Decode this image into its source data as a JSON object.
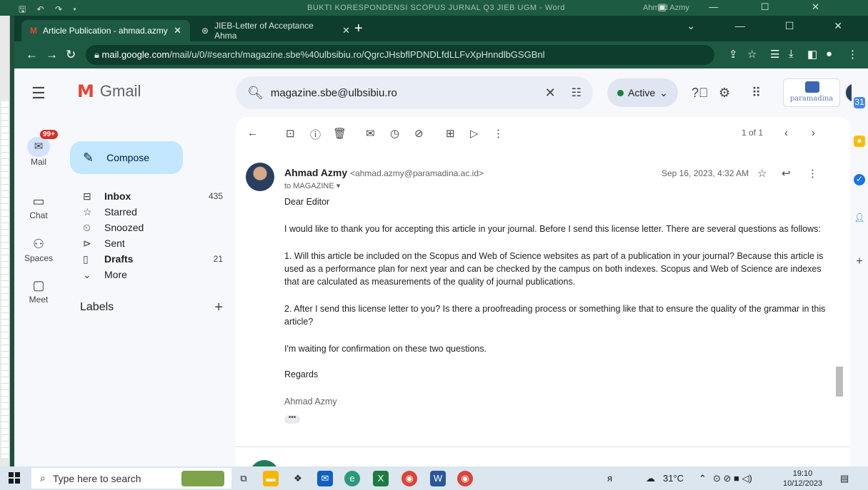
{
  "word": {
    "quick_access": "🖫 ↶ ↷ ▾",
    "document_title": "BUKTI KORESPONDENSI SCOPUS JURNAL Q3 JIEB UGM - Word",
    "user": "Ahmad Azmy",
    "user_initials": "AA",
    "window_controls": "▣ — ☐ ✕"
  },
  "browser": {
    "tabs": [
      {
        "label": "Article Publication - ahmad.azmy",
        "favicon": "M"
      },
      {
        "label": "JIEB-Letter of Acceptance Ahma",
        "favicon": "⊛"
      }
    ],
    "new_tab": "+",
    "window_controls": "⌄ — ☐ ✕",
    "url_host": "mail.google.com",
    "url_path": "/mail/u/0/#search/magazine.sbe%40ulbsibiu.ro/QgrcJHsbflPDNDLfdLLFvXpHnndlbGSGBnl"
  },
  "gmail": {
    "brand": "Gmail",
    "search_query": "magazine.sbe@ulbsibiu.ro",
    "status": "Active",
    "org_name": "paramadina",
    "rail": [
      {
        "label": "Mail",
        "badge": "99+"
      },
      {
        "label": "Chat"
      },
      {
        "label": "Spaces"
      },
      {
        "label": "Meet"
      }
    ],
    "compose_label": "Compose",
    "folders": [
      {
        "name": "Inbox",
        "count": "435",
        "icon": "inbox-icon",
        "glyph": "⊟",
        "bold": true
      },
      {
        "name": "Starred",
        "count": "",
        "icon": "star-icon",
        "glyph": "☆",
        "bold": false
      },
      {
        "name": "Snoozed",
        "count": "",
        "icon": "clock-icon",
        "glyph": "⏲",
        "bold": false
      },
      {
        "name": "Sent",
        "count": "",
        "icon": "send-icon",
        "glyph": "⊳",
        "bold": false
      },
      {
        "name": "Drafts",
        "count": "21",
        "icon": "draft-icon",
        "glyph": "▯",
        "bold": true
      },
      {
        "name": "More",
        "count": "",
        "icon": "chevron-down-icon",
        "glyph": "⌄",
        "bold": false
      }
    ],
    "labels_heading": "Labels",
    "pagination": "1 of 1",
    "message": {
      "sender_name": "Ahmad Azmy",
      "sender_email": "<ahmad.azmy@paramadina.ac.id>",
      "recipient": "to MAGAZINE ▾",
      "date": "Sep 16, 2023, 4:32 AM",
      "greeting": "Dear Editor",
      "para1": "I would like to thank you for accepting this article in your journal.  Before I send this license letter.  There are several questions as follows:",
      "para2": " 1. Will this article be included on the Scopus and Web of Science websites as part of a publication in your journal?  Because this article is used as a performance plan for next year and can be checked by the campus on both indexes.  Scopus and Web of Science are indexes that are calculated as measurements of the quality of journal publications.",
      "para3": " 2. After I send this license letter to you?  Is there a proofreading process or something like that to ensure the quality of the grammar in this article?",
      "para4": " I'm waiting for confirmation on these two questions.",
      "closing": "Regards",
      "signature": "Ahmad Azmy",
      "more_dots": "•••"
    }
  },
  "taskbar": {
    "search_placeholder": "Type here to search",
    "temperature": "31°C",
    "time": "19:10",
    "date": "10/12/2023"
  }
}
